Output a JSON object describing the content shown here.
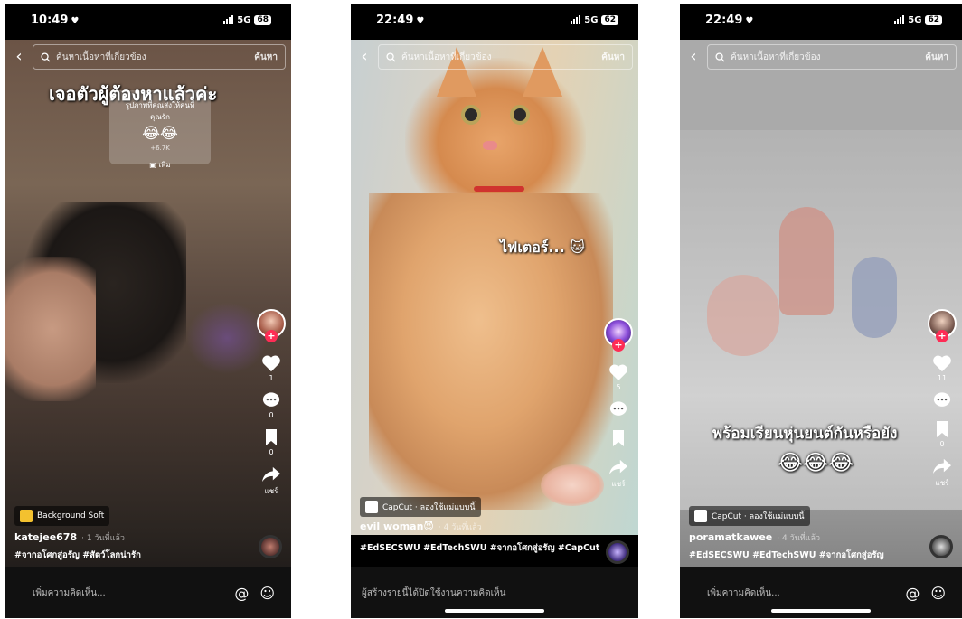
{
  "colors": {
    "accent": "#fe2c55",
    "background": "#000000"
  },
  "search": {
    "placeholder": "ค้นหาเนื้อหาที่เกี่ยวข้อง",
    "button": "ค้นหา"
  },
  "phones": [
    {
      "time": "10:49",
      "network": "5G",
      "battery": "68",
      "overlay_text": "เจอตัวผู้ต้องหาแล้วค่ะ",
      "share_tip": {
        "title": "รูปภาพที่คุณส่งให้คนที่",
        "subtitle": "คุณรัก",
        "emojis": "😂😂",
        "count": "+6.7K",
        "more": "เพิ่ม"
      },
      "counts": {
        "likes": "1",
        "comments": "0",
        "saves": "0",
        "share": "แชร์"
      },
      "chip": "Background Soft",
      "username": "katejee678",
      "when": "· 1 วันที่แล้ว",
      "hashtags": "#จากอโศกสู่อรัญ #สัตว์โลกน่ารัก",
      "comment_placeholder": "เพิ่มความคิดเห็น...",
      "icons": [
        "at-icon",
        "emoji-icon"
      ]
    },
    {
      "time": "22:49",
      "network": "5G",
      "battery": "62",
      "overlay_text": "ไฟเตอร์... 🐱",
      "counts": {
        "likes": "5",
        "comments": "",
        "saves": "",
        "share": "แชร์"
      },
      "chip": "CapCut · ลองใช้แม่แบบนี้",
      "username": "evil woman😈",
      "when": "· 4 วันที่แล้ว",
      "hashtags": "#EdSECSWU #EdTechSWU #จากอโศกสู่อรัญ #CapCut",
      "comment_placeholder": "ผู้สร้างรายนี้ได้ปิดใช้งานความคิดเห็น"
    },
    {
      "time": "22:49",
      "network": "5G",
      "battery": "62",
      "overlay_text": "พร้อมเรียนหุ่นยนต์กันหรือยัง",
      "overlay_emojis": "😂😂😂",
      "counts": {
        "likes": "11",
        "comments": "",
        "saves": "0",
        "share": "แชร์"
      },
      "chip": "CapCut · ลองใช้แม่แบบนี้",
      "username": "poramatkawee",
      "when": "· 4 วันที่แล้ว",
      "hashtags": "#EdSECSWU #EdTechSWU #จากอโศกสู่อรัญ",
      "comment_placeholder": "เพิ่มความคิดเห็น..."
    }
  ]
}
